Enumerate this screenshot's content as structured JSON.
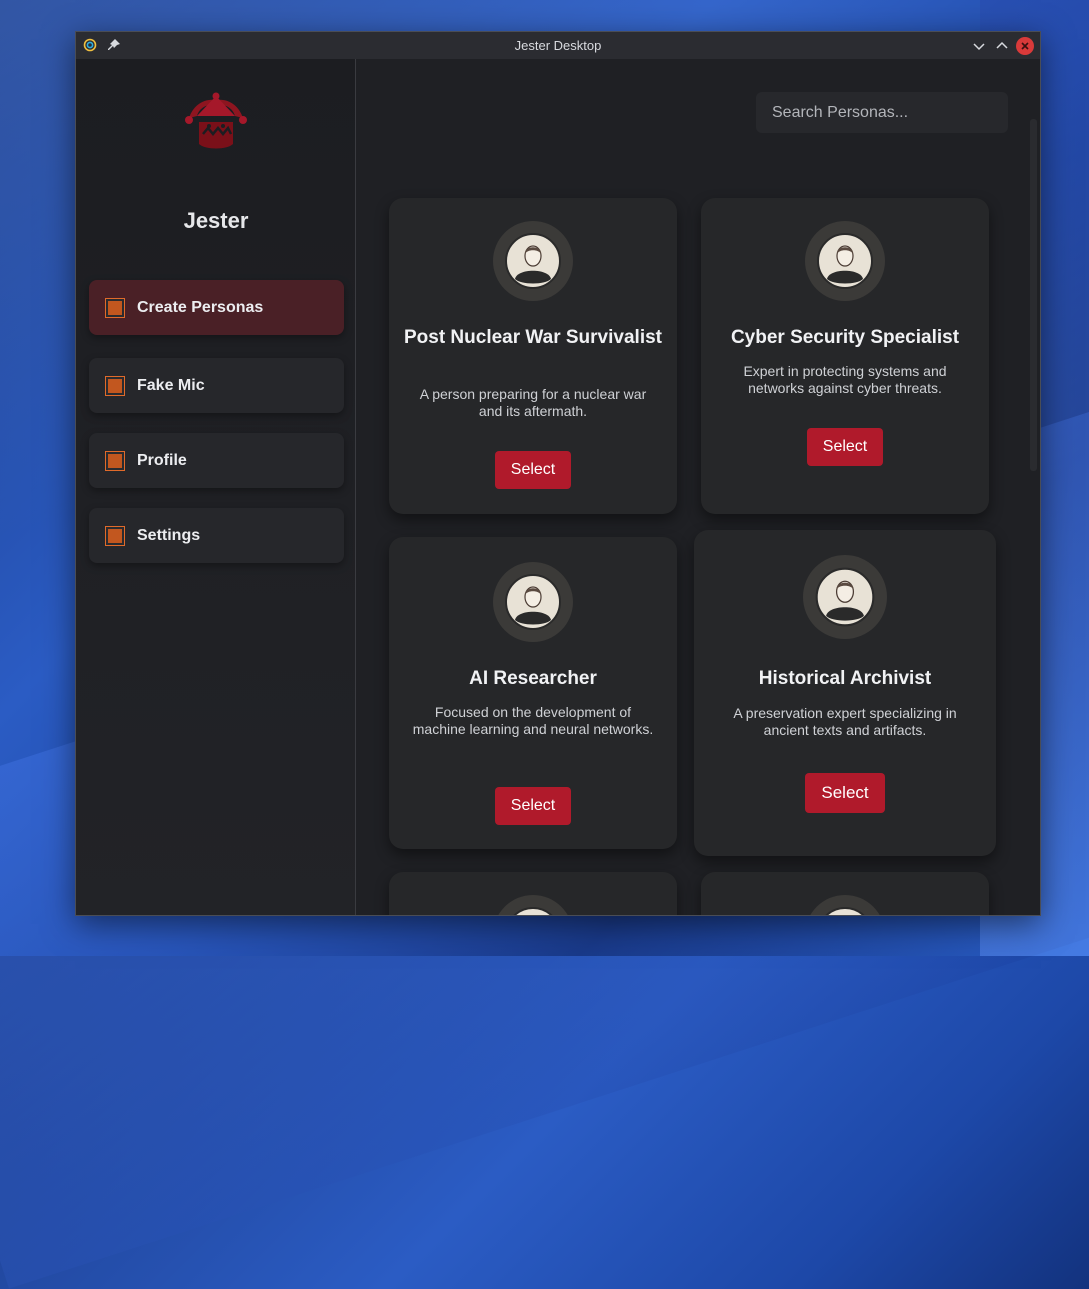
{
  "window": {
    "title": "Jester Desktop"
  },
  "sidebar": {
    "brand": "Jester",
    "items": [
      {
        "label": "Create Personas",
        "active": true
      },
      {
        "label": "Fake Mic",
        "active": false
      },
      {
        "label": "Profile",
        "active": false
      },
      {
        "label": "Settings",
        "active": false
      }
    ]
  },
  "search": {
    "placeholder": "Search Personas..."
  },
  "personas": [
    {
      "title": "Post Nuclear War Survivalist",
      "description": "A person preparing for a nuclear war and its aftermath.",
      "button": "Select"
    },
    {
      "title": "Cyber Security Specialist",
      "description": "Expert in protecting systems and networks against cyber threats.",
      "button": "Select"
    },
    {
      "title": "AI Researcher",
      "description": "Focused on the development of machine learning and neural networks.",
      "button": "Select"
    },
    {
      "title": "Historical Archivist",
      "description": "A preservation expert specializing in ancient texts and artifacts.",
      "button": "Select"
    }
  ],
  "colors": {
    "accent": "#b01a2b",
    "checkbox": "#c2571f",
    "active_nav": "#4a2026"
  }
}
